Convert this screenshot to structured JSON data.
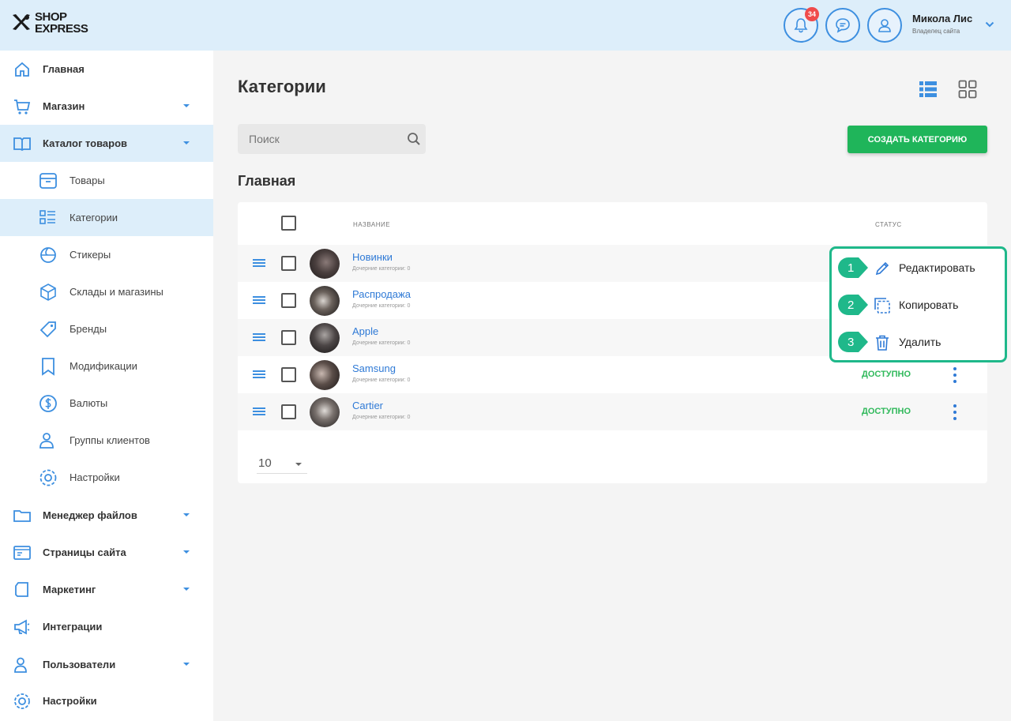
{
  "header": {
    "logo_line1": "SHOP",
    "logo_line2": "EXPRESS",
    "notification_count": "34",
    "user_name": "Микола Лис",
    "user_role": "Владелец сайта"
  },
  "sidebar": {
    "items": [
      {
        "label": "Главная",
        "icon": "home-icon"
      },
      {
        "label": "Магазин",
        "icon": "cart-icon"
      },
      {
        "label": "Каталог товаров",
        "icon": "book-icon"
      },
      {
        "label": "Менеджер файлов",
        "icon": "folder-icon"
      },
      {
        "label": "Страницы сайта",
        "icon": "pages-icon"
      },
      {
        "label": "Маркетинг",
        "icon": "marketing-icon"
      },
      {
        "label": "Интеграции",
        "icon": "megaphone-icon"
      },
      {
        "label": "Пользователи",
        "icon": "users-icon"
      },
      {
        "label": "Настройки",
        "icon": "settings-icon"
      }
    ],
    "subitems": [
      {
        "label": "Товары",
        "icon": "box-icon"
      },
      {
        "label": "Категории",
        "icon": "categories-icon"
      },
      {
        "label": "Стикеры",
        "icon": "sticker-icon"
      },
      {
        "label": "Склады и магазины",
        "icon": "warehouse-icon"
      },
      {
        "label": "Бренды",
        "icon": "tag-icon"
      },
      {
        "label": "Модификации",
        "icon": "bookmark-icon"
      },
      {
        "label": "Валюты",
        "icon": "dollar-icon"
      },
      {
        "label": "Группы клиентов",
        "icon": "user-group-icon"
      },
      {
        "label": "Настройки",
        "icon": "gear-icon"
      }
    ]
  },
  "main": {
    "title": "Категории",
    "search_placeholder": "Поиск",
    "create_button": "СОЗДАТЬ КАТЕГОРИЮ",
    "section_title": "Главная",
    "col_name": "НАЗВАНИЕ",
    "col_status": "СТАТУС",
    "rows": [
      {
        "name": "Новинки",
        "sub": "Дочерние категории: 0",
        "status": ""
      },
      {
        "name": "Распродажа",
        "sub": "Дочерние категории: 0",
        "status": ""
      },
      {
        "name": "Apple",
        "sub": "Дочерние категории: 0",
        "status": ""
      },
      {
        "name": "Samsung",
        "sub": "Дочерние категории: 0",
        "status": "ДОСТУПНО"
      },
      {
        "name": "Cartier",
        "sub": "Дочерние категории: 0",
        "status": "ДОСТУПНО"
      }
    ],
    "page_size": "10"
  },
  "context_menu": {
    "items": [
      {
        "num": "1",
        "label": "Редактировать",
        "icon": "pencil-icon"
      },
      {
        "num": "2",
        "label": "Копировать",
        "icon": "copy-icon"
      },
      {
        "num": "3",
        "label": "Удалить",
        "icon": "trash-icon"
      }
    ]
  },
  "colors": {
    "accent": "#2f7ad6",
    "header_bg": "#ddeefa",
    "primary_button": "#1fb55a",
    "status_available": "#30b95b",
    "callout": "#1fb88a"
  }
}
